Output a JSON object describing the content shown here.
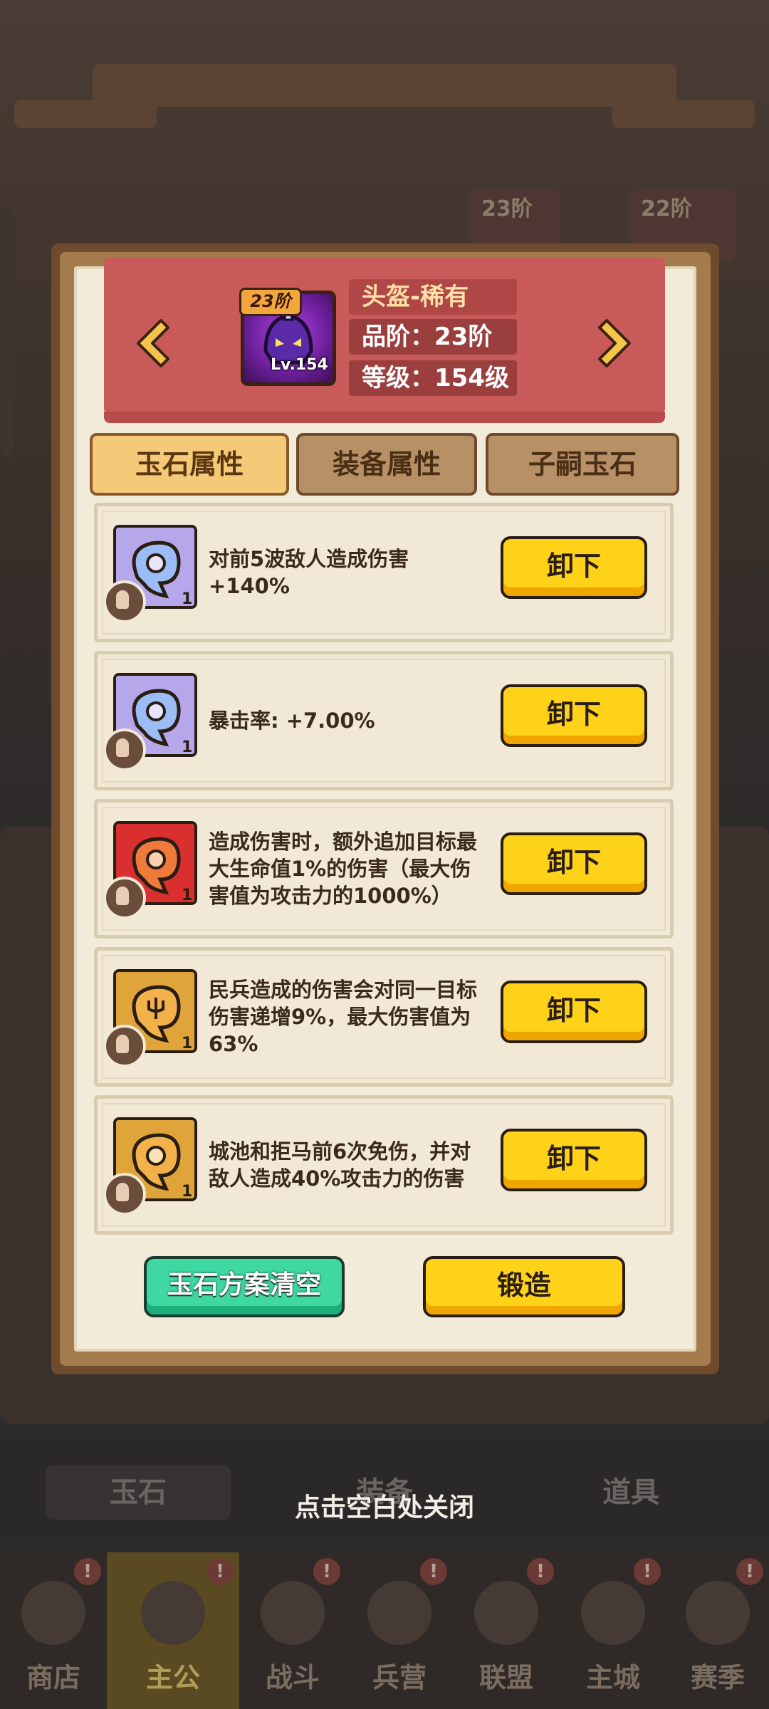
{
  "equipment": {
    "tier_badge": "23阶",
    "level_badge": "Lv.154",
    "name": "头盔-稀有",
    "grade": "品阶：23阶",
    "level": "等级：154级"
  },
  "tabs": [
    {
      "label": "玉石属性",
      "active": true
    },
    {
      "label": "装备属性",
      "active": false
    },
    {
      "label": "子嗣玉石",
      "active": false
    }
  ],
  "gems": [
    {
      "description": "对前5波敌人造成伤害+140%",
      "count": "1",
      "color": "blue",
      "action": "卸下"
    },
    {
      "description": "暴击率: +7.00%",
      "count": "1",
      "color": "blue",
      "action": "卸下"
    },
    {
      "description": "造成伤害时，额外追加目标最大生命值1%的伤害（最大伤害值为攻击力的1000%）",
      "count": "1",
      "color": "red",
      "action": "卸下"
    },
    {
      "description": "民兵造成的伤害会对同一目标伤害递增9%，最大伤害值为63%",
      "count": "1",
      "color": "gold",
      "action": "卸下"
    },
    {
      "description": "城池和拒马前6次免伤，并对敌人造成40%攻击力的伤害",
      "count": "1",
      "color": "gold",
      "action": "卸下"
    }
  ],
  "footer": {
    "clear_label": "玉石方案清空",
    "forge_label": "锻造"
  },
  "close_hint": "点击空白处关闭",
  "background": {
    "tabs": [
      "玉石",
      "装备",
      "道具"
    ],
    "nav": [
      {
        "label": "商店",
        "badge": "!"
      },
      {
        "label": "主公",
        "badge": "!",
        "active": true
      },
      {
        "label": "战斗",
        "badge": "!"
      },
      {
        "label": "兵营",
        "badge": "!"
      },
      {
        "label": "联盟",
        "badge": "!"
      },
      {
        "label": "主城",
        "badge": "!"
      },
      {
        "label": "赛季",
        "badge": "!"
      }
    ],
    "card_tiers": [
      "23阶",
      "22阶"
    ]
  },
  "colors": {
    "primary_button": "#ffd21a",
    "clear_button": "#3ed8a0",
    "header_banner": "#c95a5a"
  }
}
